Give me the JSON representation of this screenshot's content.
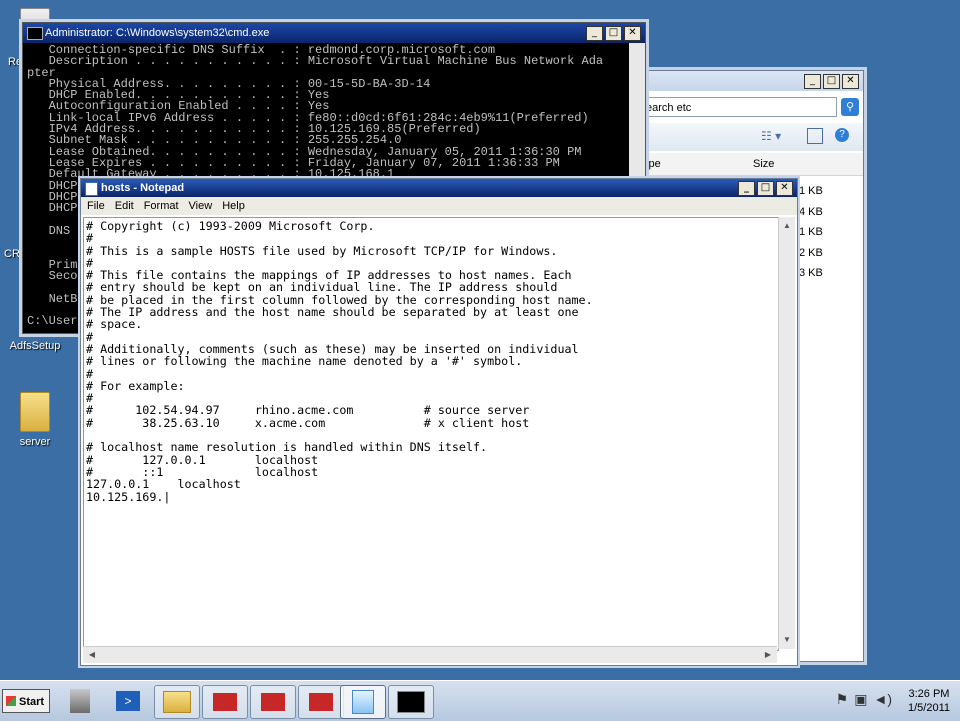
{
  "desktop": {
    "icons": [
      {
        "label": "Re",
        "icon": "recycle-bin-icon"
      },
      {
        "label": "CRM",
        "icon": "crm-icon"
      },
      {
        "label": "AdfsSetup",
        "icon": "setup-icon"
      },
      {
        "label": "server",
        "icon": "folder-icon"
      }
    ]
  },
  "explorer": {
    "search_text": "earch etc",
    "columns": [
      "ype",
      "Size"
    ],
    "rows": [
      "1 KB",
      "4 KB",
      "1 KB",
      "2 KB",
      "3 KB"
    ]
  },
  "cmd": {
    "title": "Administrator: C:\\Windows\\system32\\cmd.exe",
    "lines": [
      "   Connection-specific DNS Suffix  . : redmond.corp.microsoft.com",
      "   Description . . . . . . . . . . . : Microsoft Virtual Machine Bus Network Ada",
      "pter",
      "   Physical Address. . . . . . . . . : 00-15-5D-BA-3D-14",
      "   DHCP Enabled. . . . . . . . . . . : Yes",
      "   Autoconfiguration Enabled . . . . : Yes",
      "   Link-local IPv6 Address . . . . . : fe80::d0cd:6f61:284c:4eb9%11(Preferred)",
      "   IPv4 Address. . . . . . . . . . . : 10.125.169.85(Preferred)",
      "   Subnet Mask . . . . . . . . . . . : 255.255.254.0",
      "   Lease Obtained. . . . . . . . . . : Wednesday, January 05, 2011 1:36:30 PM",
      "   Lease Expires . . . . . . . . . . : Friday, January 07, 2011 1:36:33 PM",
      "   Default Gateway . . . . . . . . . : 10.125.168.1",
      "   DHCP",
      "   DHCP",
      "   DHCP",
      "",
      "   DNS",
      "",
      "",
      "   Prim",
      "   Seco",
      "",
      "   NetB",
      "",
      "C:\\User"
    ]
  },
  "notepad": {
    "title": "hosts - Notepad",
    "menu": [
      "File",
      "Edit",
      "Format",
      "View",
      "Help"
    ],
    "lines": [
      "# Copyright (c) 1993-2009 Microsoft Corp.",
      "#",
      "# This is a sample HOSTS file used by Microsoft TCP/IP for Windows.",
      "#",
      "# This file contains the mappings of IP addresses to host names. Each",
      "# entry should be kept on an individual line. The IP address should",
      "# be placed in the first column followed by the corresponding host name.",
      "# The IP address and the host name should be separated by at least one",
      "# space.",
      "#",
      "# Additionally, comments (such as these) may be inserted on individual",
      "# lines or following the machine name denoted by a '#' symbol.",
      "#",
      "# For example:",
      "#",
      "#      102.54.94.97     rhino.acme.com          # source server",
      "#       38.25.63.10     x.acme.com              # x client host",
      "",
      "# localhost name resolution is handled within DNS itself.",
      "#       127.0.0.1       localhost",
      "#       ::1             localhost",
      "127.0.0.1    localhost",
      "10.125.169."
    ]
  },
  "taskbar": {
    "start_label": "Start",
    "items": [
      {
        "icon": "server-manager-icon"
      },
      {
        "icon": "powershell-icon"
      },
      {
        "icon": "explorer-icon"
      },
      {
        "icon": "toolbox-icon"
      },
      {
        "icon": "toolbox-icon"
      },
      {
        "icon": "toolbox-icon"
      },
      {
        "icon": "notepad-icon"
      },
      {
        "icon": "cmd-icon"
      }
    ],
    "time": "3:26 PM",
    "date": "1/5/2011"
  }
}
